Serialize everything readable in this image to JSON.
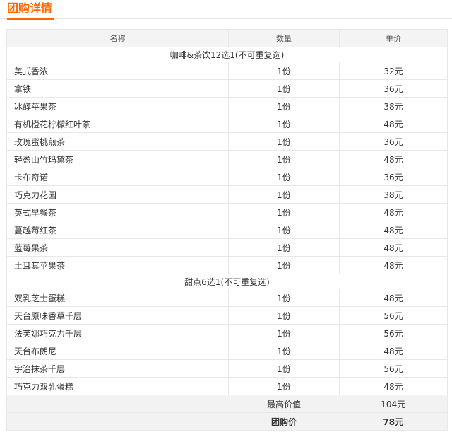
{
  "section": {
    "title": "团购详情"
  },
  "table": {
    "headers": [
      "名称",
      "数量",
      "单价"
    ],
    "groups": [
      {
        "title": "咖啡&茶饮12选1(不可重复选)",
        "items": [
          {
            "name": "美式香浓",
            "qty": "1份",
            "price": "32元"
          },
          {
            "name": "拿铁",
            "qty": "1份",
            "price": "36元"
          },
          {
            "name": "冰醇苹果茶",
            "qty": "1份",
            "price": "38元"
          },
          {
            "name": "有机橙花柠檬红叶茶",
            "qty": "1份",
            "price": "48元"
          },
          {
            "name": "玫瑰蜜桃煎茶",
            "qty": "1份",
            "price": "36元"
          },
          {
            "name": "轻盈山竹玛黛茶",
            "qty": "1份",
            "price": "48元"
          },
          {
            "name": "卡布奇诺",
            "qty": "1份",
            "price": "36元"
          },
          {
            "name": "巧克力花园",
            "qty": "1份",
            "price": "38元"
          },
          {
            "name": "英式早餐茶",
            "qty": "1份",
            "price": "48元"
          },
          {
            "name": "蔓越莓红茶",
            "qty": "1份",
            "price": "48元"
          },
          {
            "name": "蓝莓果茶",
            "qty": "1份",
            "price": "48元"
          },
          {
            "name": "土耳其苹果茶",
            "qty": "1份",
            "price": "48元"
          }
        ]
      },
      {
        "title": "甜点6选1(不可重复选)",
        "items": [
          {
            "name": "双乳芝士蛋糕",
            "qty": "1份",
            "price": "48元"
          },
          {
            "name": "天台原味香草千层",
            "qty": "1份",
            "price": "56元"
          },
          {
            "name": "法芙娜巧克力千层",
            "qty": "1份",
            "price": "56元"
          },
          {
            "name": "天台布朗尼",
            "qty": "1份",
            "price": "48元"
          },
          {
            "name": "宇治抹茶千层",
            "qty": "1份",
            "price": "56元"
          },
          {
            "name": "巧克力双乳蛋糕",
            "qty": "1份",
            "price": "48元"
          }
        ]
      }
    ],
    "summary": [
      {
        "label": "最高价值",
        "value": "104元",
        "bold": false
      },
      {
        "label": "团购价",
        "value": "78元",
        "bold": true
      }
    ]
  }
}
